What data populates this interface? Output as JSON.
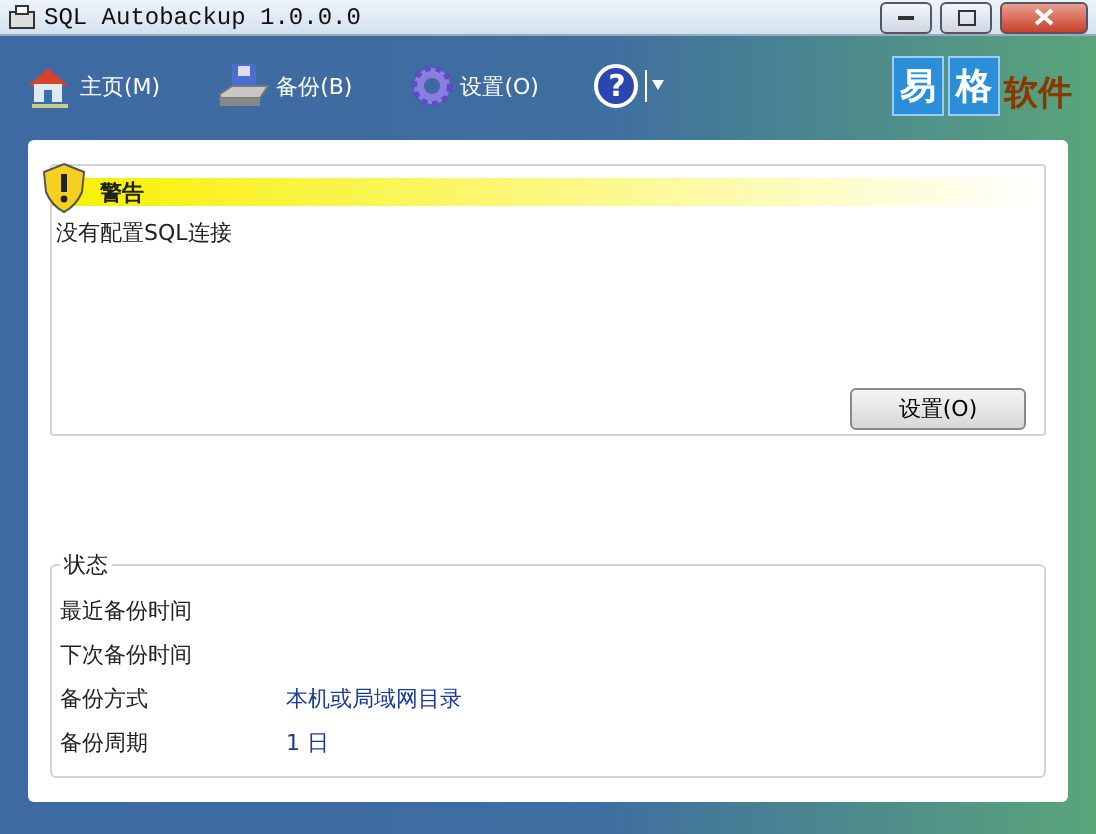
{
  "window": {
    "title": "SQL Autobackup 1.0.0.0"
  },
  "toolbar": {
    "items": [
      {
        "kind": "home",
        "label": "主页(M)"
      },
      {
        "kind": "backup",
        "label": "备份(B)"
      },
      {
        "kind": "settings",
        "label": "设置(O)"
      },
      {
        "kind": "help",
        "glyph": "?"
      }
    ],
    "logo": {
      "parts": [
        "易",
        "格",
        "软件"
      ]
    }
  },
  "warning": {
    "title": "警告",
    "message": "没有配置SQL连接",
    "button": "设置(O)"
  },
  "status": {
    "title": "状态",
    "rows": [
      {
        "label": "最近备份时间"
      },
      {
        "label": "下次备份时间"
      },
      {
        "label": "备份方式",
        "value": "本机或局域网目录"
      },
      {
        "label": "备份周期",
        "value": "1 日"
      }
    ]
  }
}
